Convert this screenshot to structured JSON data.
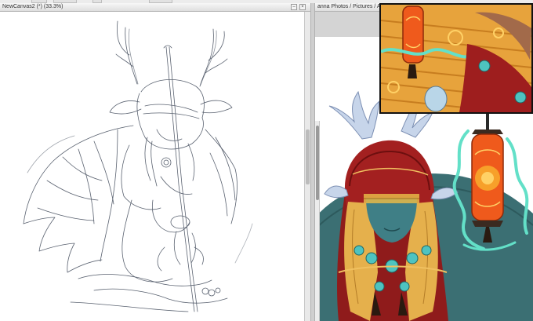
{
  "left_window": {
    "title": "NewCanvas2 (*) (33.3%)"
  },
  "right_window": {
    "title": "anna Photos / Pictures / A"
  },
  "colors": {
    "sketch_line": "#5a6270",
    "hood_red": "#9e1e1e",
    "skin_blue": "#3f7f86",
    "hair_gold": "#e5b04c",
    "teal_bg": "#3b6f73",
    "lantern_orange": "#ef5a1c",
    "ribbon_mint": "#63e0c8"
  },
  "icons": {
    "minimize": "minimize-icon",
    "close": "close-icon"
  }
}
